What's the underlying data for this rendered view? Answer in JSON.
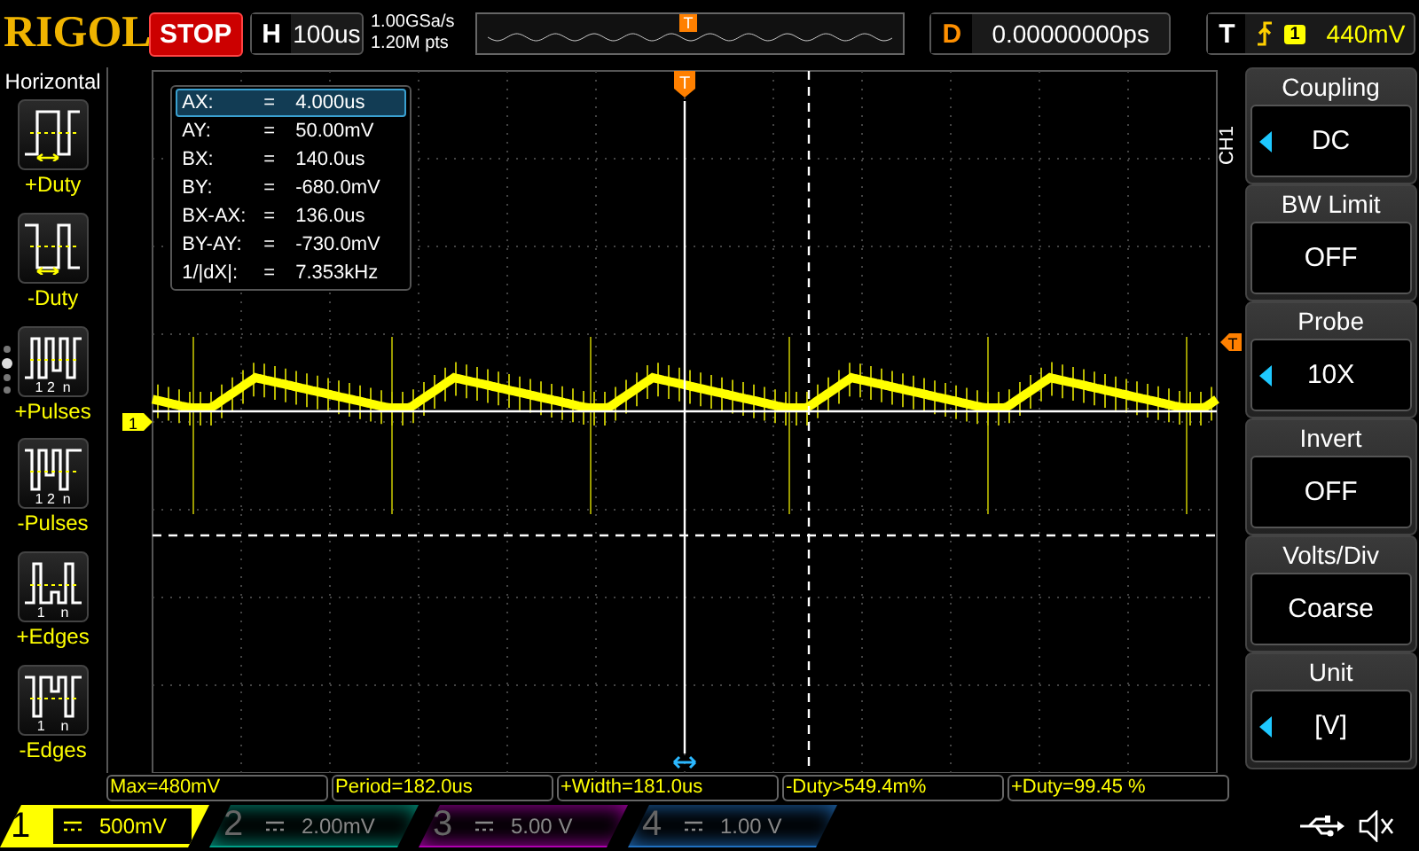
{
  "brand": "RIGOL",
  "run_state": "STOP",
  "timebase": {
    "label": "H",
    "value": "100us"
  },
  "sample_rate": "1.00GSa/s",
  "memory_depth": "1.20M pts",
  "overview_marker": "T",
  "delay": {
    "label": "D",
    "value": "0.00000000ps"
  },
  "trigger": {
    "label": "T",
    "source": "1",
    "level": "440mV"
  },
  "sidebar": {
    "title": "Horizontal",
    "items": [
      {
        "label": "+Duty",
        "kind": "pos-duty"
      },
      {
        "label": "-Duty",
        "kind": "neg-duty"
      },
      {
        "label": "+Pulses",
        "kind": "pos-pulses",
        "caption": "1 2  n"
      },
      {
        "label": "-Pulses",
        "kind": "neg-pulses",
        "caption": "1 2  n"
      },
      {
        "label": "+Edges",
        "kind": "pos-edges",
        "caption": "1    n"
      },
      {
        "label": "-Edges",
        "kind": "neg-edges",
        "caption": "1    n"
      }
    ]
  },
  "markers": {
    "trigger_time": "T",
    "trigger_level": "T",
    "channel": "1"
  },
  "cursor_readout": [
    {
      "name": "AX:",
      "sign": "=",
      "value": "4.000us",
      "selected": true
    },
    {
      "name": "AY:",
      "sign": "=",
      "value": "50.00mV",
      "selected": false
    },
    {
      "name": "BX:",
      "sign": "=",
      "value": "140.0us",
      "selected": false
    },
    {
      "name": "BY:",
      "sign": "=",
      "value": "-680.0mV",
      "selected": false
    },
    {
      "name": "BX-AX:",
      "sign": "=",
      "value": "136.0us",
      "selected": false
    },
    {
      "name": "BY-AY:",
      "sign": "=",
      "value": "-730.0mV",
      "selected": false
    },
    {
      "name": "1/|dX|:",
      "sign": "=",
      "value": "7.353kHz",
      "selected": false
    }
  ],
  "menu": {
    "channel": "CH1",
    "items": [
      {
        "title": "Coupling",
        "value": "DC",
        "adjustable": true
      },
      {
        "title": "BW Limit",
        "value": "OFF",
        "adjustable": false
      },
      {
        "title": "Probe",
        "value": "10X",
        "adjustable": true
      },
      {
        "title": "Invert",
        "value": "OFF",
        "adjustable": false
      },
      {
        "title": "Volts/Div",
        "value": "Coarse",
        "adjustable": false
      },
      {
        "title": "Unit",
        "value": "[V]",
        "adjustable": true
      }
    ]
  },
  "measurements": [
    "Max=480mV",
    "Period=182.0us",
    "+Width=181.0us",
    "-Duty>549.4m%",
    "+Duty=99.45 %"
  ],
  "channels": [
    {
      "number": "1",
      "scale": "500mV",
      "active": true,
      "color": "#ffff00"
    },
    {
      "number": "2",
      "scale": "2.00mV",
      "active": false,
      "color": "#00a088"
    },
    {
      "number": "3",
      "scale": "5.00 V",
      "active": false,
      "color": "#b000b0"
    },
    {
      "number": "4",
      "scale": "1.00 V",
      "active": false,
      "color": "#2070c0"
    }
  ]
}
